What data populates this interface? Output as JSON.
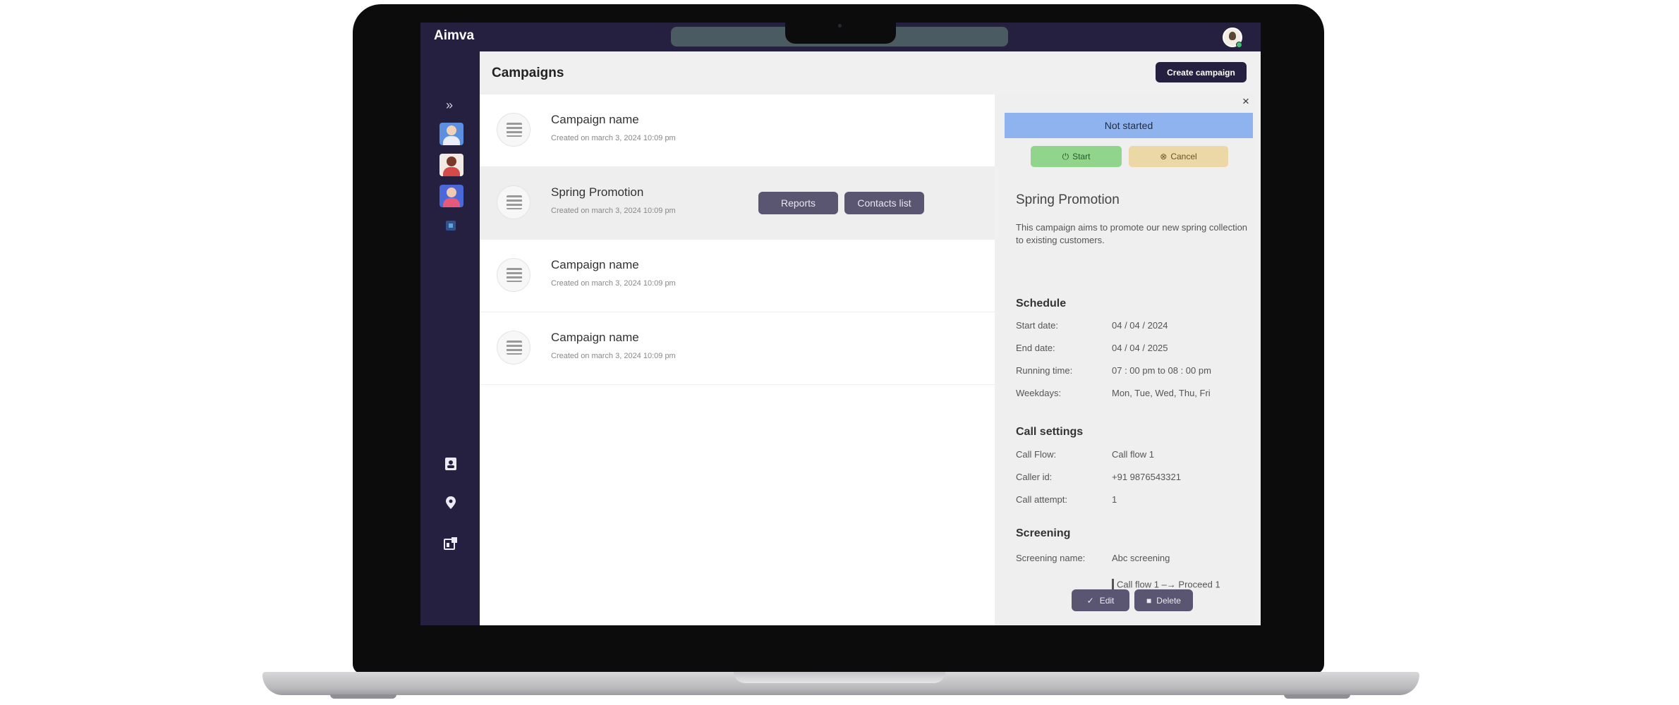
{
  "app": {
    "brand": "Aimva"
  },
  "header": {
    "title": "Campaigns",
    "create_label": "Create campaign"
  },
  "sidebar": {
    "expand_icon": "chevron-double-right-icon",
    "avatars": [
      "user-avatar-1",
      "user-avatar-2",
      "user-avatar-3"
    ],
    "bottom_icons": [
      "contacts-book-icon",
      "location-pin-icon",
      "dashboard-icon"
    ]
  },
  "campaigns": [
    {
      "name": "Campaign name",
      "created": "Created on march 3, 2024 10:09 pm"
    },
    {
      "name": "Spring Promotion",
      "created": "Created on march 3, 2024 10:09 pm",
      "actions": [
        "Reports",
        "Contacts list"
      ]
    },
    {
      "name": "Campaign name",
      "created": "Created on march 3, 2024 10:09 pm"
    },
    {
      "name": "Campaign name",
      "created": "Created on march 3, 2024 10:09 pm"
    }
  ],
  "detail": {
    "close": "×",
    "status": "Not started",
    "start_label": "Start",
    "cancel_label": "Cancel",
    "title": "Spring Promotion",
    "description": "This campaign aims to promote our new spring collection to existing customers.",
    "schedule": {
      "heading": "Schedule",
      "rows": [
        {
          "label": "Start date:",
          "value": "04 / 04 / 2024"
        },
        {
          "label": "End date:",
          "value": "04 / 04 / 2025"
        },
        {
          "label": "Running time:",
          "value": "07 : 00 pm  to  08 : 00 pm"
        },
        {
          "label": "Weekdays:",
          "value": "Mon, Tue, Wed, Thu, Fri"
        }
      ]
    },
    "call_settings": {
      "heading": "Call settings",
      "rows": [
        {
          "label": "Call Flow:",
          "value": "Call flow 1"
        },
        {
          "label": "Caller id:",
          "value": "+91 9876543321"
        },
        {
          "label": "Call attempt:",
          "value": "1"
        }
      ]
    },
    "screening": {
      "heading": "Screening",
      "rows": [
        {
          "label": "Screening name:",
          "value": "Abc screening"
        }
      ],
      "flow": "Call flow 1  –→  Proceed 1"
    },
    "edit_label": "Edit",
    "delete_label": "Delete"
  },
  "colors": {
    "sidebar_bg": "#25203f",
    "status_not_started": "#8fb3ee",
    "start_green": "#91d58c",
    "cancel_amber": "#ecd7a6",
    "button_muted": "#5a5672"
  }
}
